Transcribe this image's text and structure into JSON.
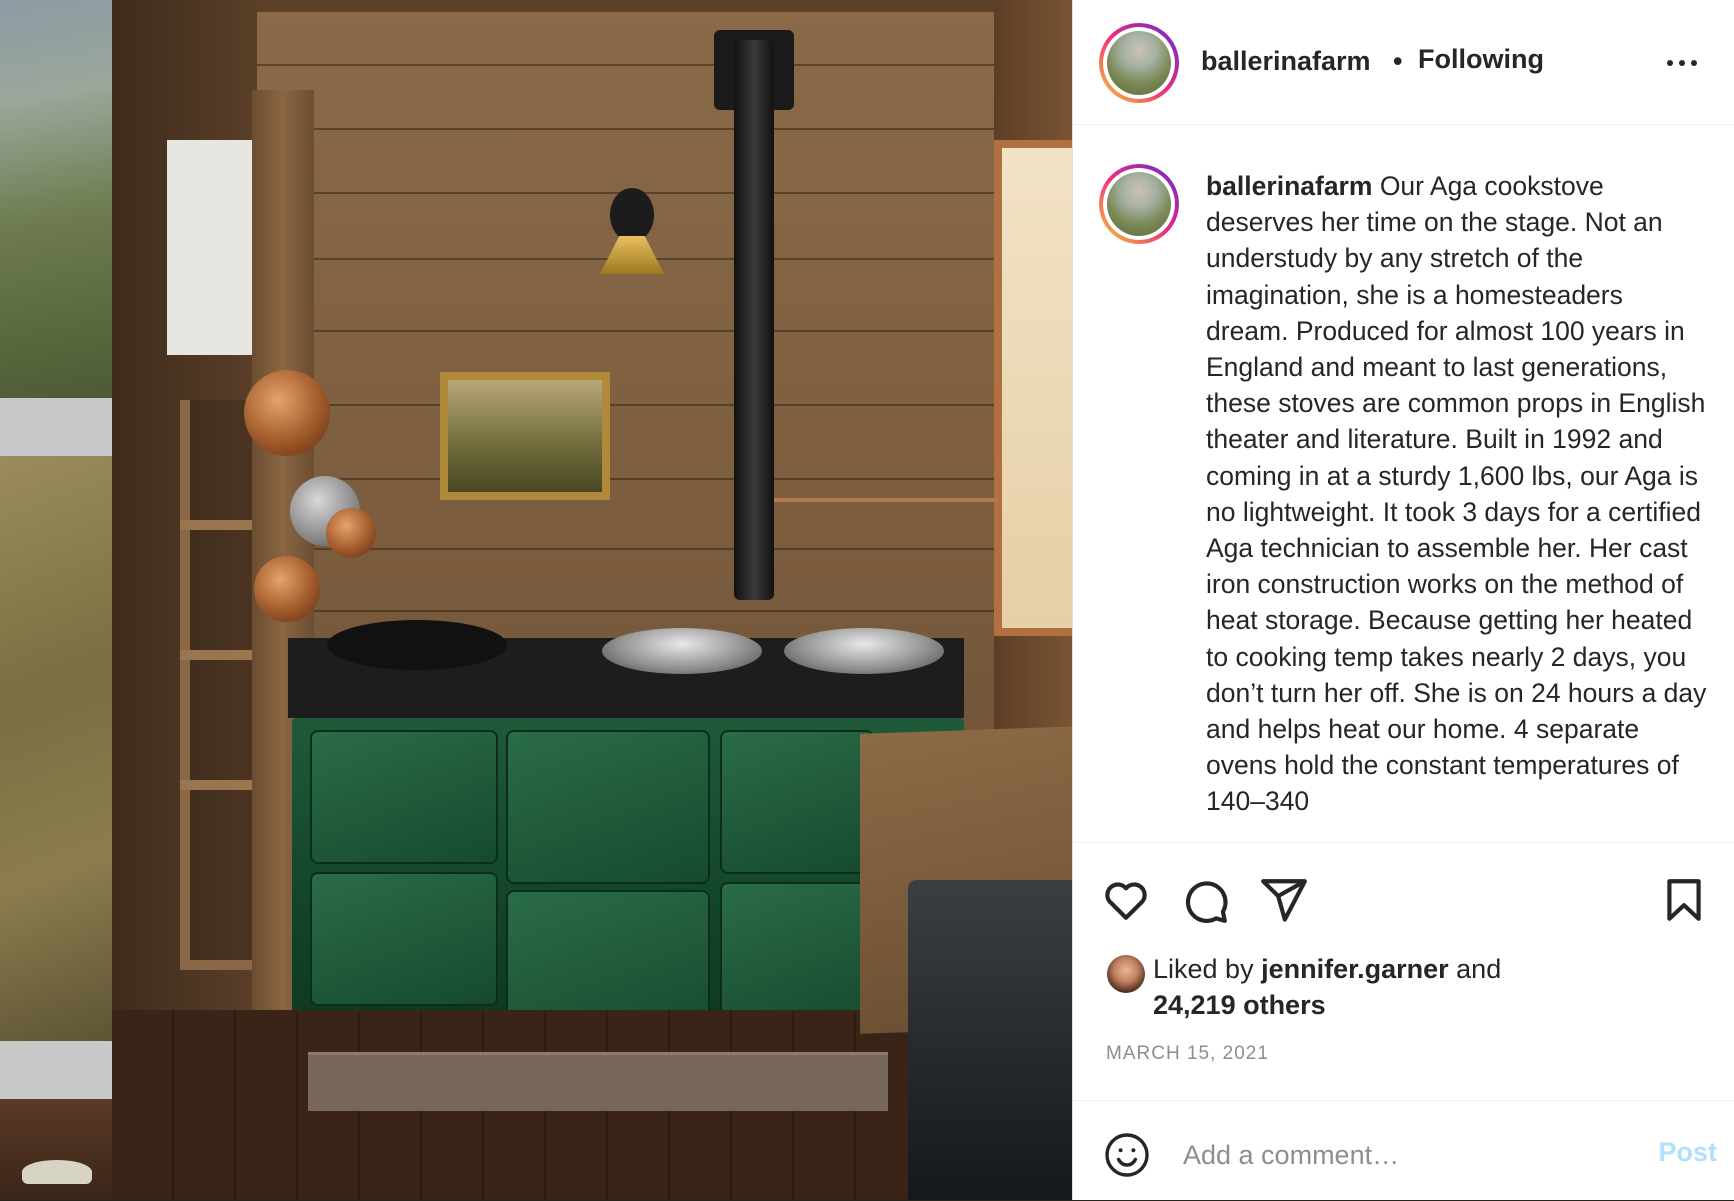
{
  "post": {
    "username": "ballerinafarm",
    "separator": "•",
    "follow_status": "Following",
    "caption_username": "ballerinafarm",
    "caption": "Our Aga cookstove deserves her time on the stage. Not an understudy by any stretch of the imagination, she is a homesteaders dream. Produced for almost 100 years in England and meant to last generations, these stoves are common props in English theater and literature. Built in 1992 and coming in at a sturdy 1,600 lbs, our Aga is no lightweight. It took 3 days for a certified Aga technician to assemble her. Her cast iron construction works on the method of heat storage. Because getting her heated to cooking temp takes nearly 2 days, you don’t turn her off. She is on 24 hours a day and helps heat our home. 4 separate ovens hold the constant temperatures of 140–340",
    "likes_prefix": "Liked by ",
    "liked_by_user": "jennifer.garner",
    "likes_and": " and",
    "likes_others": "24,219 others",
    "date": "MARCH 15, 2021"
  },
  "comment": {
    "placeholder": "Add a comment…",
    "post_label": "Post"
  },
  "icons": {
    "more": "more-icon",
    "like": "heart-icon",
    "comment": "comment-icon",
    "share": "share-icon",
    "save": "bookmark-icon",
    "emoji": "emoji-icon"
  },
  "colors": {
    "text": "#262626",
    "secondary": "#8e8e8e",
    "post_button": "#b2dffc",
    "story_ring_start": "#f9ce34",
    "story_ring_mid": "#ee2a7b",
    "story_ring_end": "#6228d7"
  }
}
